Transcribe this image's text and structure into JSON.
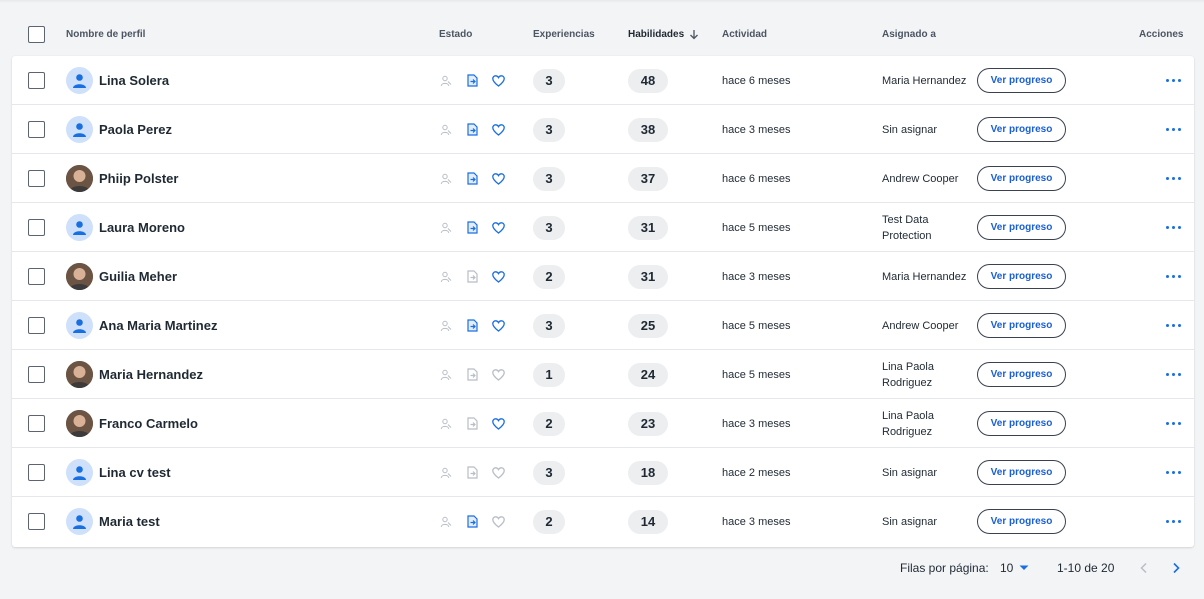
{
  "table": {
    "headers": {
      "profile_name": "Nombre de perfil",
      "status": "Estado",
      "experiences": "Experiencias",
      "skills": "Habilidades",
      "activity": "Actividad",
      "assigned_to": "Asignado a",
      "actions": "Acciones"
    },
    "sort_icon": "arrow-down-icon",
    "button_label": "Ver progreso",
    "rows": [
      {
        "name": "Lina Solera",
        "avatar": "default-user-icon",
        "status": {
          "profile": false,
          "document": true,
          "favorite": true
        },
        "experiences": "3",
        "skills": "48",
        "activity": "hace 6 meses",
        "assigned": "Maria Hernandez"
      },
      {
        "name": "Paola Perez",
        "avatar": "default-user-icon",
        "status": {
          "profile": false,
          "document": true,
          "favorite": true
        },
        "experiences": "3",
        "skills": "38",
        "activity": "hace 3 meses",
        "assigned": "Sin asignar"
      },
      {
        "name": "Phiip Polster",
        "avatar": "photo",
        "status": {
          "profile": false,
          "document": true,
          "favorite": true
        },
        "experiences": "3",
        "skills": "37",
        "activity": "hace 6 meses",
        "assigned": "Andrew Cooper"
      },
      {
        "name": "Laura Moreno",
        "avatar": "default-user-icon",
        "status": {
          "profile": false,
          "document": true,
          "favorite": true
        },
        "experiences": "3",
        "skills": "31",
        "activity": "hace 5 meses",
        "assigned": "Test Data Protection"
      },
      {
        "name": "Guilia Meher",
        "avatar": "photo",
        "status": {
          "profile": false,
          "document": false,
          "favorite": true
        },
        "experiences": "2",
        "skills": "31",
        "activity": "hace 3 meses",
        "assigned": "Maria Hernandez"
      },
      {
        "name": "Ana Maria Martinez",
        "avatar": "default-user-icon",
        "status": {
          "profile": false,
          "document": true,
          "favorite": true
        },
        "experiences": "3",
        "skills": "25",
        "activity": "hace 5 meses",
        "assigned": "Andrew Cooper"
      },
      {
        "name": "Maria Hernandez",
        "avatar": "photo",
        "status": {
          "profile": false,
          "document": false,
          "favorite": false
        },
        "experiences": "1",
        "skills": "24",
        "activity": "hace 5 meses",
        "assigned": "Lina Paola Rodriguez"
      },
      {
        "name": "Franco Carmelo",
        "avatar": "photo",
        "status": {
          "profile": false,
          "document": false,
          "favorite": true
        },
        "experiences": "2",
        "skills": "23",
        "activity": "hace 3 meses",
        "assigned": "Lina Paola Rodriguez"
      },
      {
        "name": "Lina cv test",
        "avatar": "default-user-icon",
        "status": {
          "profile": false,
          "document": false,
          "favorite": false
        },
        "experiences": "3",
        "skills": "18",
        "activity": "hace 2 meses",
        "assigned": "Sin asignar"
      },
      {
        "name": "Maria test",
        "avatar": "default-user-icon",
        "status": {
          "profile": false,
          "document": true,
          "favorite": false
        },
        "experiences": "2",
        "skills": "14",
        "activity": "hace 3 meses",
        "assigned": "Sin asignar"
      }
    ]
  },
  "pagination": {
    "rows_per_page_label": "Filas por página:",
    "rows_per_page_value": "10",
    "range": "1-10 de 20"
  },
  "colors": {
    "accent": "#1a6fe0",
    "link": "#1a5fd6",
    "inactive_icon": "#b8bec6",
    "pill_bg": "#eceef0",
    "avatar_bg": "#cfe0fb"
  }
}
